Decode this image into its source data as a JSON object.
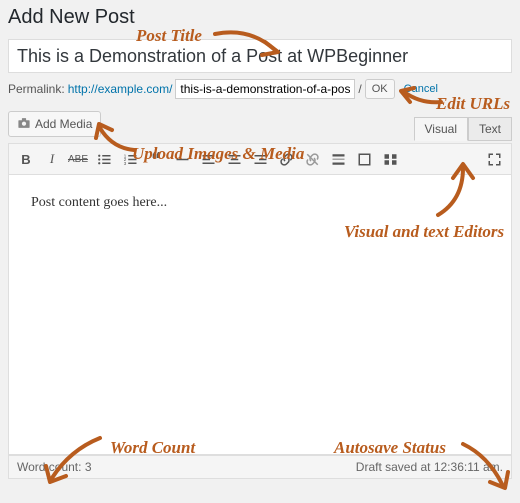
{
  "header": {
    "page_title": "Add New Post"
  },
  "title": {
    "value": "This is a Demonstration of a Post at WPBeginner"
  },
  "permalink": {
    "label": "Permalink:",
    "base": "http://example.com/",
    "slug": "this-is-a-demonstration-of-a-pos",
    "ok": "OK",
    "cancel": "Cancel"
  },
  "media": {
    "button": "Add Media"
  },
  "tabs": {
    "visual": "Visual",
    "text": "Text"
  },
  "toolbar": {
    "bold": "B",
    "italic": "I",
    "strike": "ABE",
    "ul": "≡",
    "ol": "≡",
    "quote": "❝",
    "hr": "—",
    "left": "≡",
    "center": "≡",
    "right": "≡",
    "link": "🔗",
    "unlink": "⛓",
    "more": "⋯",
    "fs": "⛶",
    "kitchen": "⊞"
  },
  "content": {
    "body": "Post content goes here..."
  },
  "status": {
    "wordcount_label": "Word count:",
    "wordcount": "3",
    "autosave": "Draft saved at 12:36:11 am."
  },
  "annotations": {
    "post_title": "Post Title",
    "edit_urls": "Edit URLs",
    "upload": "Upload Images & Media",
    "editors": "Visual and text Editors",
    "wordcount": "Word Count",
    "autosave": "Autosave Status"
  },
  "accent": "#b85c1e"
}
